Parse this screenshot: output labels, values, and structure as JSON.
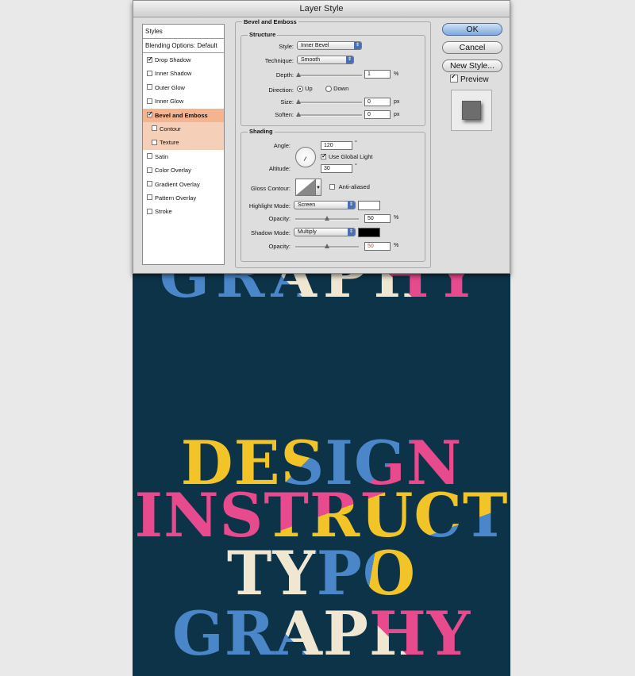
{
  "artwork": {
    "peek_text": "GRAPHY",
    "lines": [
      "DESIGN",
      "INSTRUCT",
      "TYPO",
      "GRAPHY"
    ]
  },
  "dialog": {
    "title": "Layer Style",
    "styles_header": "Styles",
    "blending_options": "Blending Options: Default",
    "style_items": [
      {
        "label": "Drop Shadow",
        "checked": true
      },
      {
        "label": "Inner Shadow",
        "checked": false
      },
      {
        "label": "Outer Glow",
        "checked": false
      },
      {
        "label": "Inner Glow",
        "checked": false
      },
      {
        "label": "Bevel and Emboss",
        "checked": true
      },
      {
        "label": "Contour",
        "checked": false
      },
      {
        "label": "Texture",
        "checked": false
      },
      {
        "label": "Satin",
        "checked": false
      },
      {
        "label": "Color Overlay",
        "checked": false
      },
      {
        "label": "Gradient Overlay",
        "checked": false
      },
      {
        "label": "Pattern Overlay",
        "checked": false
      },
      {
        "label": "Stroke",
        "checked": false
      }
    ],
    "panel_title": "Bevel and Emboss",
    "structure": {
      "title": "Structure",
      "style_label": "Style:",
      "style_value": "Inner Bevel",
      "technique_label": "Technique:",
      "technique_value": "Smooth",
      "depth_label": "Depth:",
      "depth_value": "1",
      "depth_unit": "%",
      "depth_level": 0.01,
      "direction_label": "Direction:",
      "direction_up": "Up",
      "direction_down": "Down",
      "size_label": "Size:",
      "size_value": "0",
      "size_unit": "px",
      "soften_label": "Soften:",
      "soften_value": "0",
      "soften_unit": "px"
    },
    "shading": {
      "title": "Shading",
      "angle_label": "Angle:",
      "angle_value": "120",
      "angle_unit": "°",
      "global_light_label": "Use Global Light",
      "altitude_label": "Altitude:",
      "altitude_value": "30",
      "altitude_unit": "°",
      "gloss_contour_label": "Gloss Contour:",
      "anti_aliased_label": "Anti-aliased",
      "highlight_mode_label": "Highlight Mode:",
      "highlight_mode_value": "Screen",
      "highlight_color": "#ffffff",
      "highlight_opacity_label": "Opacity:",
      "highlight_opacity_value": "50",
      "highlight_opacity_unit": "%",
      "shadow_mode_label": "Shadow Mode:",
      "shadow_mode_value": "Multiply",
      "shadow_color": "#000000",
      "shadow_opacity_label": "Opacity:",
      "shadow_opacity_value": "50",
      "shadow_opacity_unit": "%"
    },
    "buttons": {
      "ok": "OK",
      "cancel": "Cancel",
      "new_style": "New Style..."
    },
    "preview_label": "Preview"
  },
  "colors": {
    "background": "#0d3349",
    "pink": "#e84a8e",
    "blue": "#4a86c8",
    "yellow": "#f2c428",
    "cream": "#f0e7d3",
    "active_style": "#f3b48f"
  }
}
